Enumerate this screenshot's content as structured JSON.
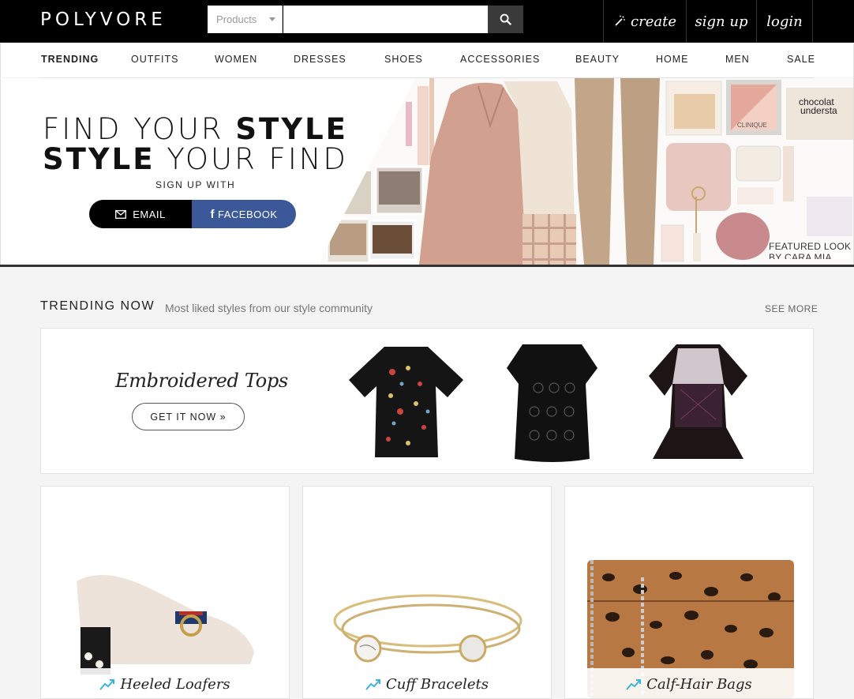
{
  "header": {
    "logo": "POLYVORE",
    "search": {
      "category": "Products",
      "placeholder": ""
    },
    "actions": {
      "create": "create",
      "signup": "sign up",
      "login": "login"
    }
  },
  "nav": [
    "TRENDING",
    "OUTFITS",
    "WOMEN",
    "DRESSES",
    "SHOES",
    "ACCESSORIES",
    "BEAUTY",
    "HOME",
    "MEN",
    "SALE"
  ],
  "hero": {
    "line1_light": "FIND YOUR ",
    "line1_bold": "STYLE",
    "line2_bold": "STYLE",
    "line2_light": " YOUR FIND",
    "signup_with": "SIGN UP WITH",
    "email_label": "EMAIL",
    "facebook_label": "FACEBOOK",
    "featured_line1": "FEATURED LOOK",
    "featured_line2": "BY CARA MIA",
    "collage_texts": {
      "chocolate": "chocolat",
      "understand": "understa",
      "clinique": "CLINIQUE"
    }
  },
  "trending": {
    "title": "TRENDING NOW",
    "subtitle": "Most liked styles from our style community",
    "see_more": "SEE MORE"
  },
  "promo": {
    "title": "Embroidered Tops",
    "button": "GET IT NOW »"
  },
  "cards": [
    {
      "label": "Heeled Loafers"
    },
    {
      "label": "Cuff Bracelets"
    },
    {
      "label": "Calf-Hair Bags"
    }
  ],
  "colors": {
    "facebook": "#3b5998",
    "trend_icon": "#3bb3d6"
  }
}
